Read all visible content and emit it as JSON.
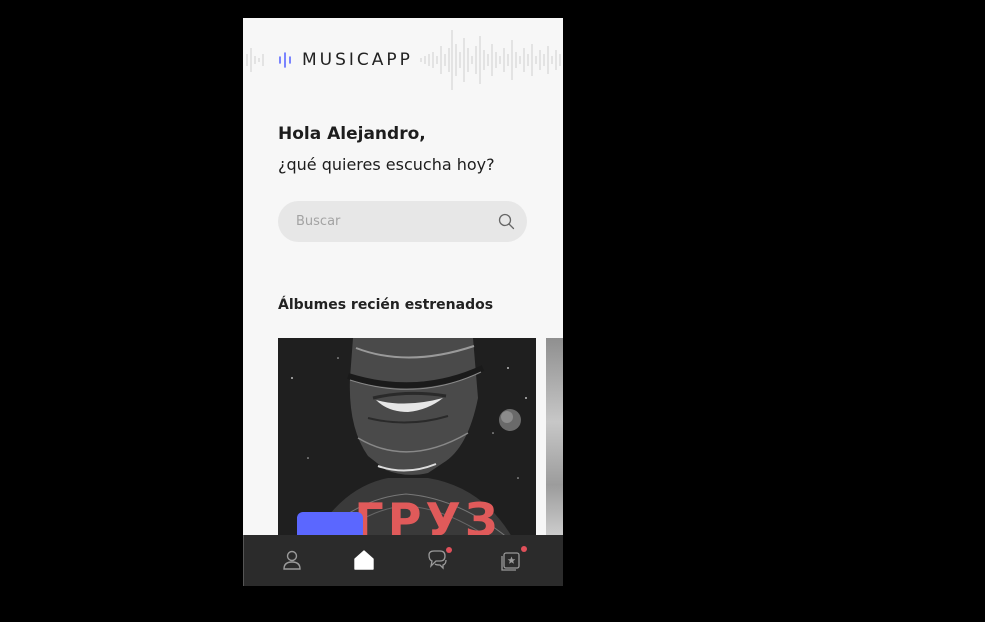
{
  "app": {
    "logo_text": "MUSICAPP",
    "accent_color": "#5b67ff"
  },
  "greeting": {
    "title": "Hola Alejandro,",
    "subtitle": "¿qué quieres escucha hoy?"
  },
  "search": {
    "placeholder": "Buscar",
    "icon": "search-icon"
  },
  "albums": {
    "section_title": "Álbumes recién estrenados",
    "cover_text": "ГРУЗ"
  },
  "navbar": {
    "items": [
      {
        "icon": "user-icon",
        "active": false
      },
      {
        "icon": "home-icon",
        "active": true
      },
      {
        "icon": "chat-icon",
        "active": false,
        "badge": true
      },
      {
        "icon": "favorites-icon",
        "active": false,
        "badge": true
      }
    ],
    "badge_color": "#e0505a"
  }
}
